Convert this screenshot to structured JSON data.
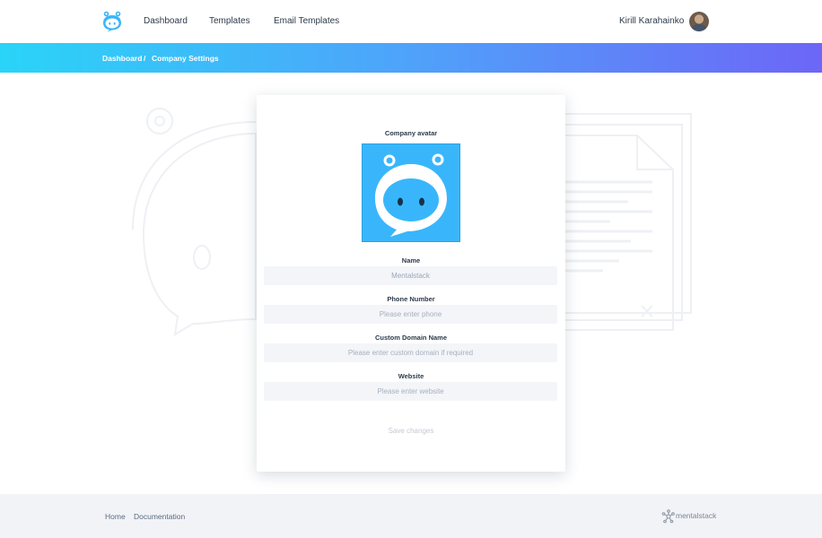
{
  "nav": {
    "links": [
      "Dashboard",
      "Templates",
      "Email Templates"
    ],
    "user_name": "Kirill Karahainko"
  },
  "breadcrumb": {
    "items": [
      "Dashboard",
      "/",
      "Company Settings"
    ]
  },
  "form": {
    "avatar_label": "Company avatar",
    "name_label": "Name",
    "name_value": "Mentalstack",
    "phone_label": "Phone Number",
    "phone_placeholder": "Please enter phone",
    "domain_label": "Custom Domain Name",
    "domain_placeholder": "Please enter custom domain if required",
    "website_label": "Website",
    "website_placeholder": "Please enter website",
    "save_label": "Save changes"
  },
  "footer": {
    "links": [
      "Home",
      "Documentation"
    ],
    "brand": "mentalstack"
  },
  "colors": {
    "accent": "#39b6fb",
    "banner_start": "#2ad4f8",
    "banner_end": "#6d66f7"
  },
  "icons": {
    "logo": "robot-head-icon",
    "brand": "network-nodes-icon"
  }
}
